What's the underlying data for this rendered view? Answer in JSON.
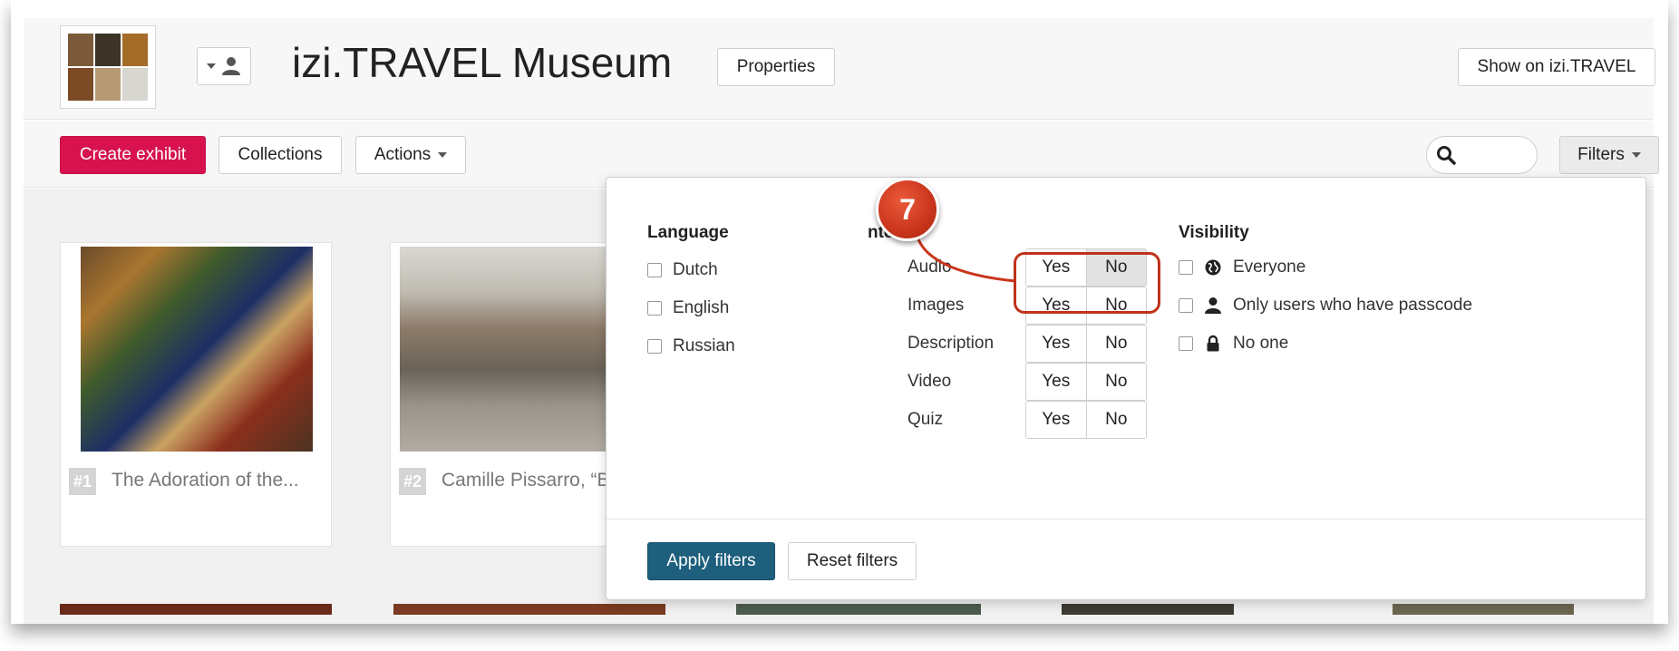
{
  "header": {
    "title": "izi.TRAVEL Museum",
    "properties_label": "Properties",
    "show_on_label": "Show on izi.TRAVEL"
  },
  "toolbar": {
    "create_label": "Create exhibit",
    "collections_label": "Collections",
    "actions_label": "Actions",
    "filters_label": "Filters",
    "search_value": ""
  },
  "exhibits": [
    {
      "number": "#1",
      "title": "The Adoration of the..."
    },
    {
      "number": "#2",
      "title": "Camille Pissarro, “Bo"
    }
  ],
  "filters": {
    "language": {
      "heading": "Language",
      "options": [
        {
          "label": "Dutch",
          "checked": false
        },
        {
          "label": "English",
          "checked": false
        },
        {
          "label": "Russian",
          "checked": false
        }
      ]
    },
    "content": {
      "heading": "Content",
      "heading_visible": "ntent",
      "yes_label": "Yes",
      "no_label": "No",
      "rows": [
        {
          "label": "Audio",
          "selected": "No"
        },
        {
          "label": "Images",
          "selected": ""
        },
        {
          "label": "Description",
          "selected": ""
        },
        {
          "label": "Video",
          "selected": ""
        },
        {
          "label": "Quiz",
          "selected": ""
        }
      ]
    },
    "visibility": {
      "heading": "Visibility",
      "options": [
        {
          "label": "Everyone",
          "icon": "globe-icon",
          "checked": false
        },
        {
          "label": "Only users who have passcode",
          "icon": "user-icon",
          "checked": false
        },
        {
          "label": "No one",
          "icon": "lock-icon",
          "checked": false
        }
      ]
    },
    "apply_label": "Apply filters",
    "reset_label": "Reset filters"
  },
  "annotation": {
    "step": "7",
    "color": "#c9351c"
  },
  "colors": {
    "create_button": "#d7124e",
    "apply_button": "#1d5f7d"
  }
}
